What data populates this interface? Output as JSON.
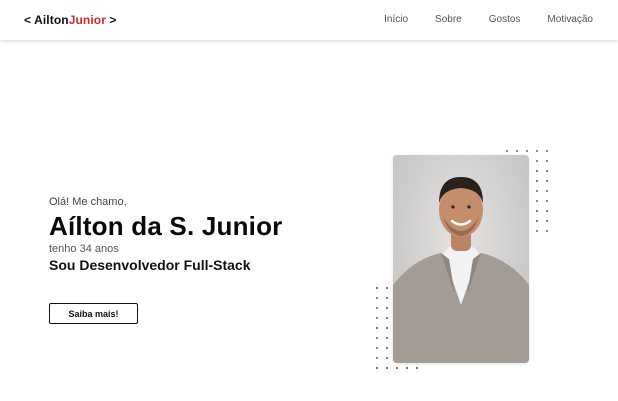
{
  "header": {
    "logo": {
      "prefix": "< ",
      "first": "Ailton",
      "accent": "Junior",
      "suffix": " >"
    },
    "nav": [
      {
        "label": "Início"
      },
      {
        "label": "Sobre"
      },
      {
        "label": "Gostos"
      },
      {
        "label": "Motivação"
      }
    ]
  },
  "hero": {
    "greeting": "Olá! Me chamo,",
    "name": "Aílton da S. Junior",
    "age": "tenho 34 anos",
    "role": "Sou Desenvolvedor Full-Stack",
    "cta_label": "Saiba mais!"
  },
  "colors": {
    "accent": "#d62828",
    "text": "#111111"
  },
  "icons": {
    "photo": "portrait-photo",
    "dots": "dot-grid-decoration"
  }
}
